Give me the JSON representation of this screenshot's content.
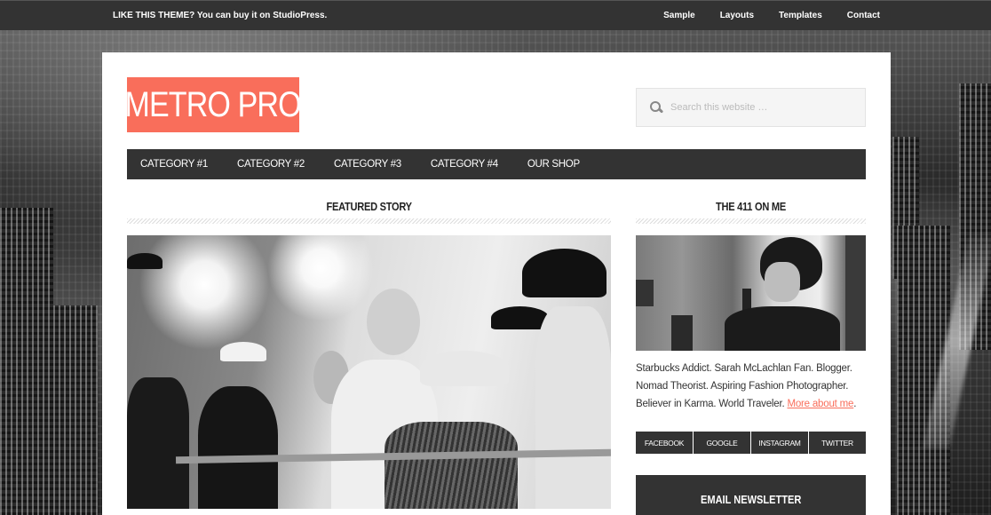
{
  "top_bar": {
    "promo": "LIKE THIS THEME? You can buy it on StudioPress.",
    "nav": [
      "Sample",
      "Layouts",
      "Templates",
      "Contact"
    ]
  },
  "header": {
    "logo": "METRO PRO",
    "search_placeholder": "Search this website …",
    "search_icon": "search-icon"
  },
  "main_nav": [
    "CATEGORY #1",
    "CATEGORY #2",
    "CATEGORY #3",
    "CATEGORY #4",
    "OUR SHOP"
  ],
  "content": {
    "featured_title": "FEATURED STORY"
  },
  "sidebar": {
    "about_title": "THE 411 ON ME",
    "bio_text": "Starbucks Addict. Sarah McLachlan Fan. Blogger. Nomad Theorist. Aspiring Fashion Photographer. Believer in Karma. World Traveler. ",
    "bio_link": "More about me",
    "bio_end": ".",
    "social": [
      "FACEBOOK",
      "GOOGLE",
      "INSTAGRAM",
      "TWITTER"
    ],
    "newsletter_title": "EMAIL NEWSLETTER"
  },
  "colors": {
    "accent": "#f96e5b",
    "dark": "#333333",
    "search_bg": "#f5f5f5"
  }
}
